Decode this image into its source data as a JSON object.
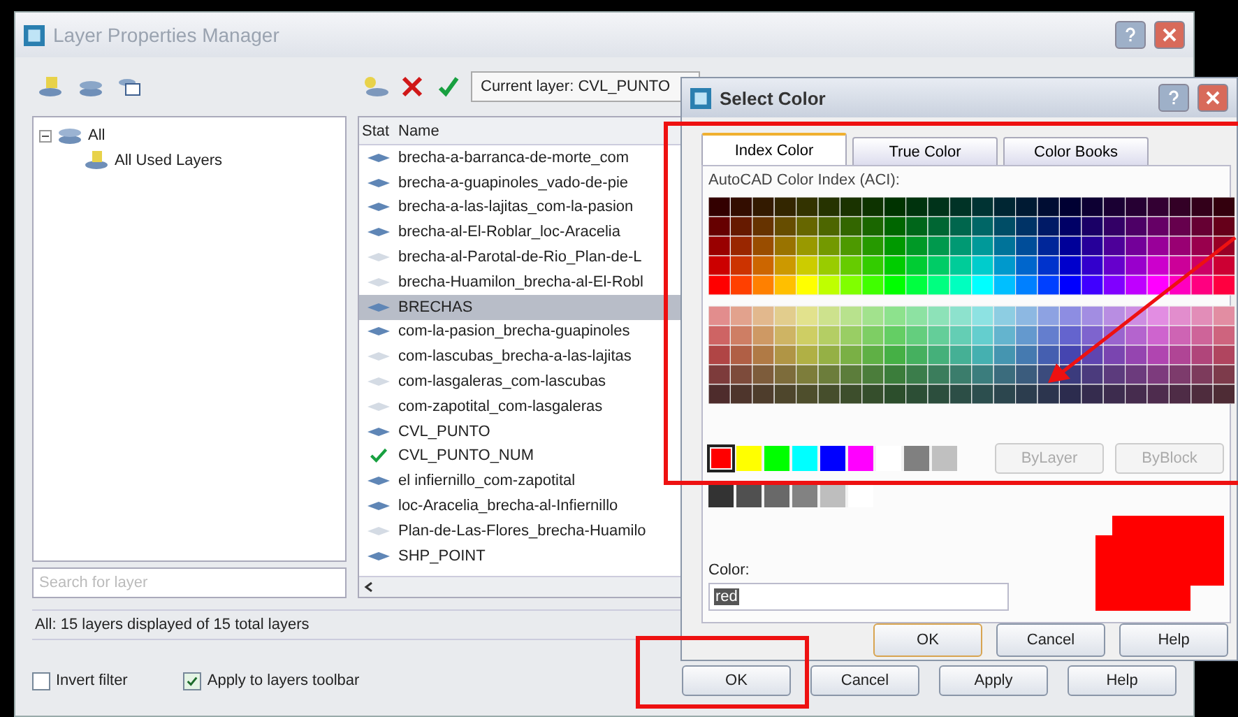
{
  "layer_manager": {
    "title": "Layer Properties Manager",
    "current_layer": "Current layer: CVL_PUNTO",
    "tree": {
      "label": "All",
      "expanded": true,
      "children": [
        {
          "label": "All Used Layers"
        }
      ]
    },
    "search": {
      "placeholder": "Search for layer"
    },
    "columns": [
      "Stat",
      "Name"
    ],
    "layers": [
      {
        "name": "brecha-a-barranca-de-morte_com",
        "kind": "used",
        "selected": false
      },
      {
        "name": "brecha-a-guapinoles_vado-de-pie",
        "kind": "used",
        "selected": false
      },
      {
        "name": "brecha-a-las-lajitas_com-la-pasion",
        "kind": "used",
        "selected": false
      },
      {
        "name": "brecha-al-El-Roblar_loc-Aracelia",
        "kind": "used",
        "selected": false
      },
      {
        "name": "brecha-al-Parotal-de-Rio_Plan-de-L",
        "kind": "unused",
        "selected": false
      },
      {
        "name": "brecha-Huamilon_brecha-al-El-Robl",
        "kind": "unused",
        "selected": false
      },
      {
        "name": "BRECHAS",
        "kind": "used",
        "selected": true
      },
      {
        "name": "com-la-pasion_brecha-guapinoles",
        "kind": "used",
        "selected": false
      },
      {
        "name": "com-lascubas_brecha-a-las-lajitas",
        "kind": "unused",
        "selected": false
      },
      {
        "name": "com-lasgaleras_com-lascubas",
        "kind": "unused",
        "selected": false
      },
      {
        "name": "com-zapotital_com-lasgaleras",
        "kind": "unused",
        "selected": false
      },
      {
        "name": "CVL_PUNTO",
        "kind": "used",
        "selected": false
      },
      {
        "name": "CVL_PUNTO_NUM",
        "kind": "current",
        "selected": false
      },
      {
        "name": "el infiernillo_com-zapotital",
        "kind": "used",
        "selected": false
      },
      {
        "name": "loc-Aracelia_brecha-al-Infiernillo",
        "kind": "used",
        "selected": false
      },
      {
        "name": "Plan-de-Las-Flores_brecha-Huamilo",
        "kind": "unused",
        "selected": false
      },
      {
        "name": "SHP_POINT",
        "kind": "used",
        "selected": false
      }
    ],
    "status_bar": "All: 15 layers displayed of 15 total layers",
    "options": [
      {
        "label": "Invert filter",
        "checked": false
      },
      {
        "label": "Apply to layers toolbar",
        "checked": true
      }
    ],
    "buttons": [
      "OK",
      "Cancel",
      "Apply",
      "Help"
    ]
  },
  "select_color": {
    "title": "Select Color",
    "tabs": [
      {
        "label": "Index Color",
        "selected": true
      },
      {
        "label": "True Color",
        "selected": false
      },
      {
        "label": "Color Books",
        "selected": false
      }
    ],
    "palette_label": "AutoCAD Color Index (ACI):",
    "standard_colors": [
      {
        "color": "#ff0000",
        "selected": true
      },
      {
        "color": "#ffff00",
        "selected": false
      },
      {
        "color": "#00ff00",
        "selected": false
      },
      {
        "color": "#00ffff",
        "selected": false
      },
      {
        "color": "#0000ff",
        "selected": false
      },
      {
        "color": "#ff00ff",
        "selected": false
      },
      {
        "color": "#ffffff",
        "selected": false
      },
      {
        "color": "#808080",
        "selected": false
      },
      {
        "color": "#c0c0c0",
        "selected": false
      }
    ],
    "by_buttons": [
      {
        "label": "ByLayer",
        "disabled": true
      },
      {
        "label": "ByBlock",
        "disabled": true
      }
    ],
    "gray_colors": [
      {
        "color": "#333333",
        "selected": false
      },
      {
        "color": "#505050",
        "selected": false
      },
      {
        "color": "#696969",
        "selected": false
      },
      {
        "color": "#828282",
        "selected": false
      },
      {
        "color": "#bebebe",
        "selected": false
      },
      {
        "color": "#ffffff",
        "selected": false
      }
    ],
    "color_label": "Color:",
    "color_value": "red",
    "buttons": [
      "OK",
      "Cancel",
      "Help"
    ]
  }
}
